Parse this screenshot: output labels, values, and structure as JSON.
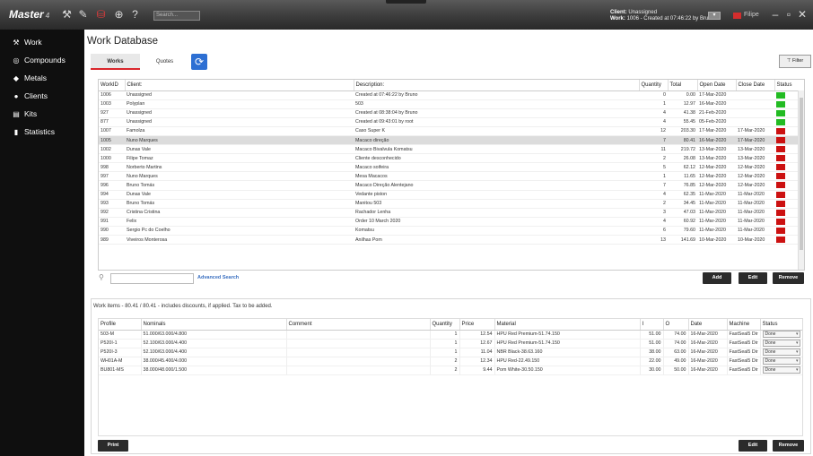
{
  "app": {
    "brand": "Master",
    "brand_version": "4",
    "search_placeholder": "Search...",
    "session_client_label": "Client:",
    "session_client_value": "Unassigned",
    "session_work_label": "Work:",
    "session_work_value": "1006 - Created at 07:46:22 by Bru",
    "language": "Filipe"
  },
  "sidebar": {
    "items": [
      {
        "label": "Work",
        "icon": "hammer-icon"
      },
      {
        "label": "Compounds",
        "icon": "compounds-icon"
      },
      {
        "label": "Metals",
        "icon": "metals-icon"
      },
      {
        "label": "Clients",
        "icon": "user-icon"
      },
      {
        "label": "Kits",
        "icon": "document-icon"
      },
      {
        "label": "Statistics",
        "icon": "bar-chart-icon"
      }
    ]
  },
  "page": {
    "title": "Work Database",
    "tabs": [
      "Works",
      "Quotes"
    ],
    "filter_label": "Filter",
    "advanced_search": "Advanced Search",
    "add_label": "Add",
    "edit_label": "Edit",
    "remove_label": "Remove"
  },
  "works_table": {
    "headers": [
      "WorkID",
      "Client:",
      "Description:",
      "Quantity",
      "Total",
      "Open Date",
      "Close Date",
      "Status"
    ],
    "rows": [
      {
        "id": "1006",
        "client": "Unassigned",
        "desc": "Created at 07:46:22 by Bruno",
        "qty": "0",
        "total": "0.00",
        "open": "17-Mar-2020",
        "close": "",
        "status": "open"
      },
      {
        "id": "1003",
        "client": "Polyplan",
        "desc": "503",
        "qty": "1",
        "total": "12.97",
        "open": "16-Mar-2020",
        "close": "",
        "status": "open"
      },
      {
        "id": "927",
        "client": "Unassigned",
        "desc": "Created at 08:38:04 by Bruno",
        "qty": "4",
        "total": "41.38",
        "open": "21-Feb-2020",
        "close": "",
        "status": "open"
      },
      {
        "id": "877",
        "client": "Unassigned",
        "desc": "Created at 09:43:01 by root",
        "qty": "4",
        "total": "55.45",
        "open": "05-Feb-2020",
        "close": "",
        "status": "open"
      },
      {
        "id": "1007",
        "client": "Famolza",
        "desc": "Caso Super K",
        "qty": "12",
        "total": "203.30",
        "open": "17-Mar-2020",
        "close": "17-Mar-2020",
        "status": "closed"
      },
      {
        "id": "1005",
        "client": "Nuno Marques",
        "desc": "Macaco direção",
        "qty": "7",
        "total": "80.41",
        "open": "16-Mar-2020",
        "close": "17-Mar-2020",
        "status": "closed"
      },
      {
        "id": "1002",
        "client": "Dunas Vale",
        "desc": "Macaco Bivalvula Komatsu",
        "qty": "11",
        "total": "219.72",
        "open": "13-Mar-2020",
        "close": "13-Mar-2020",
        "status": "closed"
      },
      {
        "id": "1000",
        "client": "Filipe Tomaz",
        "desc": "Cliente desconhecido",
        "qty": "2",
        "total": "26.08",
        "open": "13-Mar-2020",
        "close": "13-Mar-2020",
        "status": "closed"
      },
      {
        "id": "998",
        "client": "Norberto Martins",
        "desc": "Macaco soifeira",
        "qty": "5",
        "total": "62.12",
        "open": "12-Mar-2020",
        "close": "12-Mar-2020",
        "status": "closed"
      },
      {
        "id": "997",
        "client": "Nuno Marques",
        "desc": "Mesa Macacos",
        "qty": "1",
        "total": "11.65",
        "open": "12-Mar-2020",
        "close": "12-Mar-2020",
        "status": "closed"
      },
      {
        "id": "996",
        "client": "Bruno Tomás",
        "desc": "Macaco Direção Alentejano",
        "qty": "7",
        "total": "76.85",
        "open": "12-Mar-2020",
        "close": "12-Mar-2020",
        "status": "closed"
      },
      {
        "id": "994",
        "client": "Dunas Vale",
        "desc": "Vedante piston",
        "qty": "4",
        "total": "62.35",
        "open": "11-Mar-2020",
        "close": "11-Mar-2020",
        "status": "closed"
      },
      {
        "id": "993",
        "client": "Bruno Tomás",
        "desc": "Manitou 503",
        "qty": "2",
        "total": "34.45",
        "open": "11-Mar-2020",
        "close": "11-Mar-2020",
        "status": "closed"
      },
      {
        "id": "992",
        "client": "Cristina Cristina",
        "desc": "Rachador Lenha",
        "qty": "3",
        "total": "47.03",
        "open": "11-Mar-2020",
        "close": "11-Mar-2020",
        "status": "closed"
      },
      {
        "id": "991",
        "client": "Felix",
        "desc": "Order 10 March 2020",
        "qty": "4",
        "total": "60.92",
        "open": "11-Mar-2020",
        "close": "11-Mar-2020",
        "status": "closed"
      },
      {
        "id": "990",
        "client": "Sergio Pc do Coelho",
        "desc": "Komatsu",
        "qty": "6",
        "total": "79.60",
        "open": "11-Mar-2020",
        "close": "11-Mar-2020",
        "status": "closed"
      },
      {
        "id": "989",
        "client": "Viveiros Monterosa",
        "desc": "Anilhas Pom",
        "qty": "13",
        "total": "141.69",
        "open": "10-Mar-2020",
        "close": "10-Mar-2020",
        "status": "closed"
      }
    ]
  },
  "status_colors": {
    "open": "#22bb22",
    "closed": "#cc1111"
  },
  "work_items": {
    "title": "Work items - 80.41 / 80.41 - includes discounts, if applied. Tax to be added.",
    "headers": [
      "Profile",
      "Nominals",
      "Comment",
      "Quantity",
      "Price",
      "Material",
      "I",
      "O",
      "Date",
      "Machine",
      "Status"
    ],
    "rows": [
      {
        "profile": "503-M",
        "nominals": "51.000/63.000/4.800",
        "comment": "",
        "qty": "1",
        "price": "12.54",
        "material": "HPU Red Premium-51.74.150",
        "i": "51.00",
        "o": "74.00",
        "date": "16-Mar-2020",
        "machine": "FastSeal5 Dir",
        "status": "Done"
      },
      {
        "profile": "P520I-1",
        "nominals": "52.100/63.000/4.400",
        "comment": "",
        "qty": "1",
        "price": "12.67",
        "material": "HPU Red Premium-51.74.150",
        "i": "51.00",
        "o": "74.00",
        "date": "16-Mar-2020",
        "machine": "FastSeal5 Dir",
        "status": "Done"
      },
      {
        "profile": "P520I-3",
        "nominals": "52.100/63.000/4.400",
        "comment": "",
        "qty": "1",
        "price": "11.04",
        "material": "NBR Black-38.63.160",
        "i": "38.00",
        "o": "63.00",
        "date": "16-Mar-2020",
        "machine": "FastSeal5 Dir",
        "status": "Done"
      },
      {
        "profile": "WH01A-M",
        "nominals": "38.000/45.400/4.000",
        "comment": "",
        "qty": "2",
        "price": "12.34",
        "material": "HPU Red-22.49.150",
        "i": "22.00",
        "o": "49.00",
        "date": "16-Mar-2020",
        "machine": "FastSeal5 Dir",
        "status": "Done"
      },
      {
        "profile": "BU801-MS",
        "nominals": "38.000/48.000/1.500",
        "comment": "",
        "qty": "2",
        "price": "9.44",
        "material": "Pom White-30.50.150",
        "i": "30.00",
        "o": "50.00",
        "date": "16-Mar-2020",
        "machine": "FastSeal5 Dir",
        "status": "Done"
      }
    ],
    "print_label": "Print",
    "edit_label": "Edit",
    "remove_label": "Remove"
  }
}
